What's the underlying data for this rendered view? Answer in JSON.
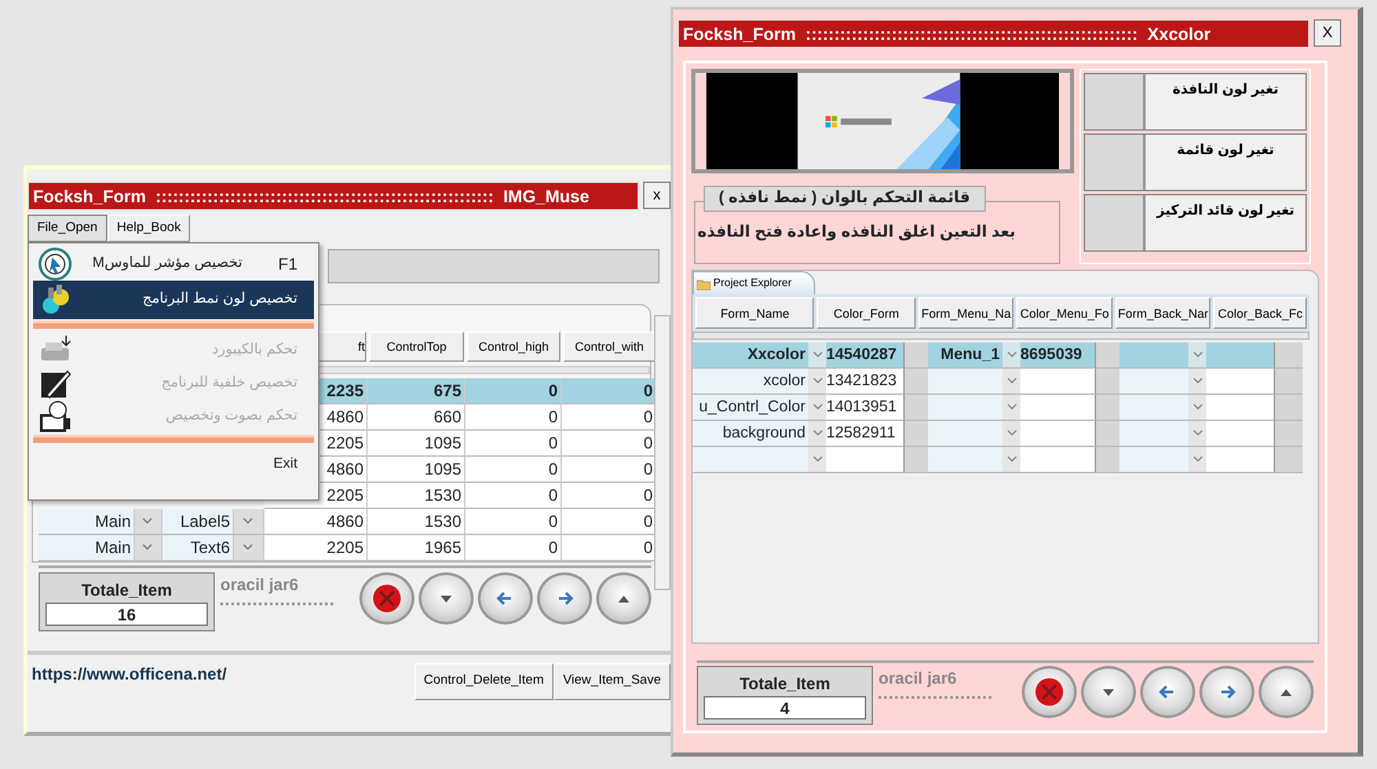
{
  "left_window": {
    "title": "Focksh_Form  :::::::::::::::::::::::::::::::::::::::::::::::::::::::::::  IMG_Muse",
    "close": "x",
    "menu_bar": [
      {
        "label": "File_Open",
        "selected": true
      },
      {
        "label": "Help_Book",
        "selected": false
      }
    ],
    "menu": [
      {
        "kind": "item",
        "label": "تخصيص مؤشر للماوسM",
        "shortcut": "F1",
        "selected": false,
        "disabled": false
      },
      {
        "kind": "item",
        "label": "تخصيص لون نمط البرنامج",
        "selected": true,
        "disabled": false
      },
      {
        "kind": "separator"
      },
      {
        "kind": "item",
        "label": "تحكم بالكيبورد",
        "selected": false,
        "disabled": true
      },
      {
        "kind": "item",
        "label": "تخصيص خلفية للبرنامج",
        "selected": false,
        "disabled": true
      },
      {
        "kind": "item",
        "label": "تحكم بصوت وتخصيص",
        "selected": false,
        "disabled": true
      },
      {
        "kind": "separator"
      },
      {
        "kind": "item",
        "label": "Exit",
        "selected": false,
        "disabled": false
      }
    ],
    "columns": [
      "ft",
      "ControlTop",
      "Control_high",
      "Control_with"
    ],
    "rows": [
      {
        "values": [
          "2235",
          "675",
          "0",
          "0"
        ],
        "selected": true
      },
      {
        "values": [
          "4860",
          "660",
          "0",
          "0"
        ],
        "selected": false
      },
      {
        "values": [
          "2205",
          "1095",
          "0",
          "0"
        ],
        "selected": false
      },
      {
        "values": [
          "4860",
          "1095",
          "0",
          "0"
        ],
        "selected": false
      },
      {
        "values": [
          "2205",
          "1530",
          "0",
          "0"
        ],
        "selected": false
      },
      {
        "form": "Main",
        "control": "Label5",
        "values": [
          "4860",
          "1530",
          "0",
          "0"
        ],
        "selected": false
      },
      {
        "form": "Main",
        "control": "Text6",
        "values": [
          "2205",
          "1965",
          "0",
          "0"
        ],
        "selected": false
      }
    ],
    "total_label": "Totale_Item",
    "total_value": "16",
    "caption": "oracil jar6",
    "link": "https://www.officena.net/",
    "buttons": [
      "Control_Delete_Item",
      "View_Item_Save"
    ]
  },
  "right_window": {
    "title": "Focksh_Form  ::::::::::::::::::::::::::::::::::::::::::::::::::::::::::  Xxcolor",
    "close": "X",
    "color_buttons": [
      "تغير لون النافذة",
      "تغير لون قائمة",
      "تغير لون قائد التركيز"
    ],
    "group_title": "قائمة التحكم بالوان ( نمط نافذه )",
    "group_text": "بعد التعين اغلق النافذه واعادة فتح النافذه",
    "tab": "Project Explorer",
    "columns": [
      "Form_Name",
      "Color_Form",
      "Form_Menu_Na",
      "Color_Menu_Fo",
      "Form_Back_Nar",
      "Color_Back_Fc"
    ],
    "rows": [
      {
        "form_name": "Xxcolor",
        "color_form": "14540287",
        "menu_name": "Menu_1",
        "menu_color": "8695039",
        "selected": true
      },
      {
        "form_name": "xcolor",
        "color_form": "13421823",
        "selected": false
      },
      {
        "form_name": "u_Contrl_Color",
        "color_form": "14013951",
        "selected": false
      },
      {
        "form_name": "background",
        "color_form": "12582911",
        "selected": false
      },
      {
        "selected": false
      }
    ],
    "total_label": "Totale_Item",
    "total_value": "4",
    "caption": "oracil jar6"
  }
}
